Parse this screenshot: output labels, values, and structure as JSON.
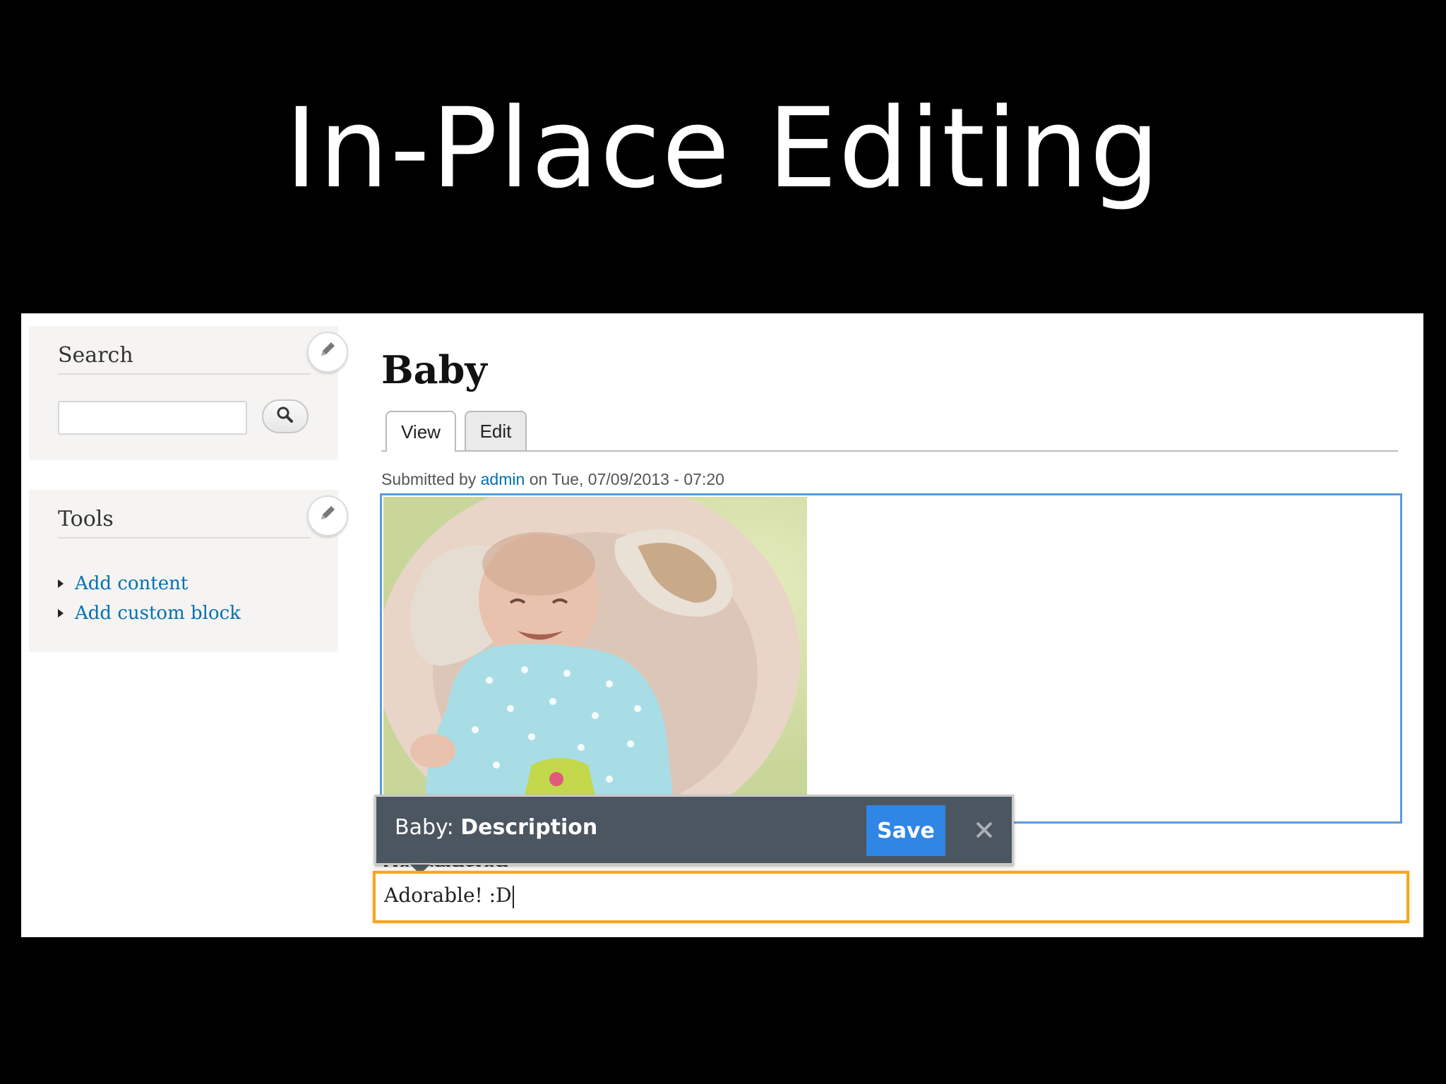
{
  "slide": {
    "title": "In-Place Editing"
  },
  "sidebar": {
    "search": {
      "title": "Search",
      "input_value": "",
      "button_icon": "search-icon",
      "edit_icon": "pencil-icon"
    },
    "tools": {
      "title": "Tools",
      "edit_icon": "pencil-icon",
      "items": [
        {
          "label": "Add content"
        },
        {
          "label": "Add custom block"
        }
      ]
    }
  },
  "main": {
    "title": "Baby",
    "tabs": [
      {
        "label": "View",
        "active": true
      },
      {
        "label": "Edit",
        "active": false
      }
    ],
    "submitted": {
      "prefix": "Submitted by",
      "author": "admin",
      "suffix": "on Tue, 07/09/2013 - 07:20"
    }
  },
  "edit_toolbar": {
    "entity": "Baby:",
    "field": "Description",
    "save_label": "Save",
    "close_icon": "close-icon"
  },
  "description_field": {
    "label": "Description",
    "value": "Adorable! :D"
  },
  "colors": {
    "link": "#0071b3",
    "image_field_outline": "#5b9bde",
    "active_field_outline": "#f6a623",
    "toolbar_bg": "#4c5660",
    "save_button": "#2f86e4"
  }
}
